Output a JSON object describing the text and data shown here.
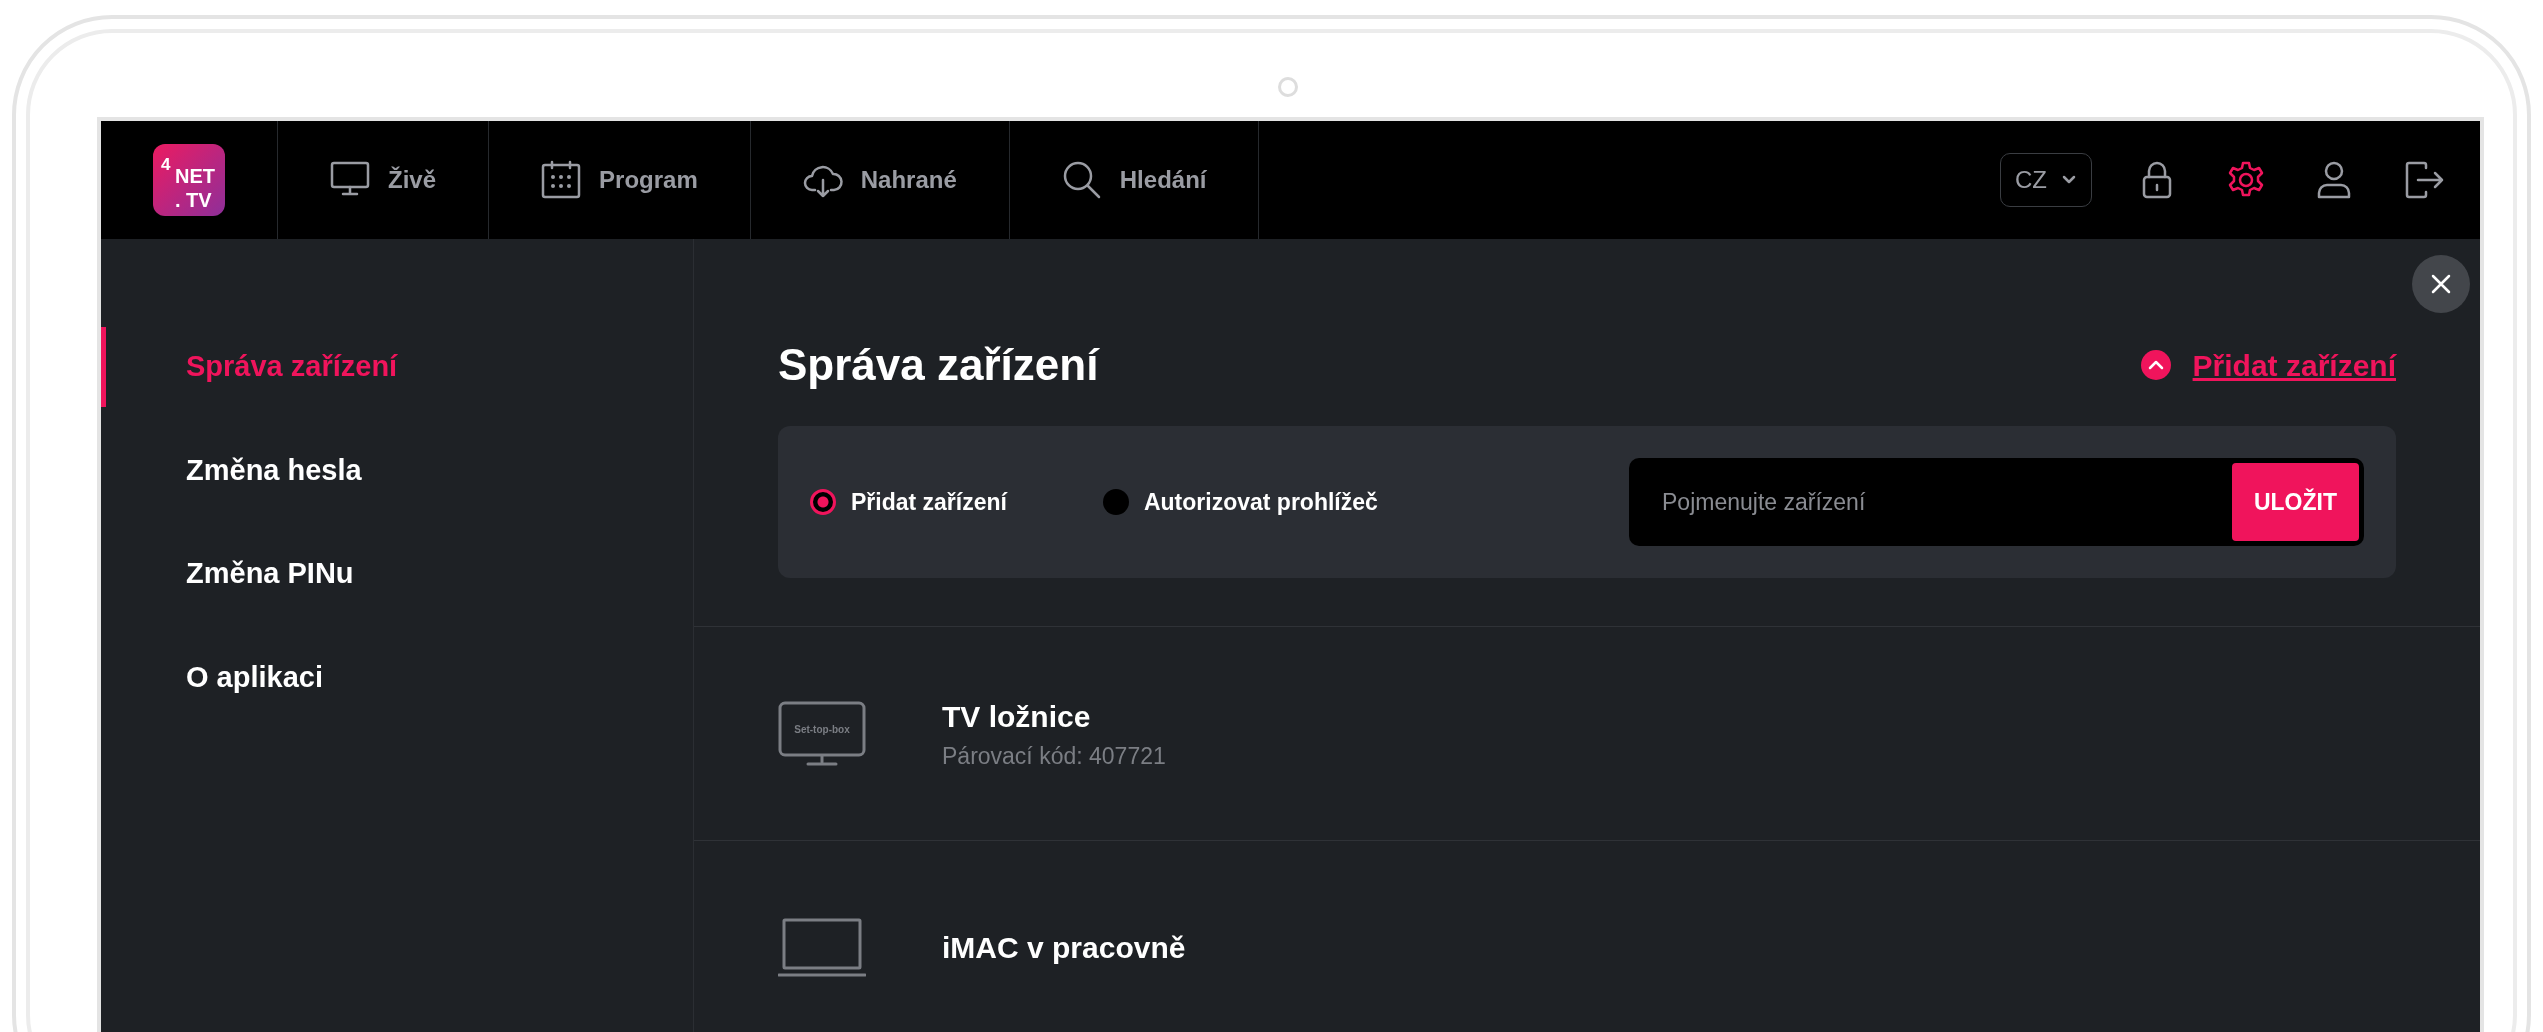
{
  "logo": {
    "lines": [
      "4",
      "NET",
      ". TV"
    ]
  },
  "nav": [
    {
      "kind": "monitor",
      "label": "Živě"
    },
    {
      "kind": "calendar",
      "label": "Program"
    },
    {
      "kind": "cloud",
      "label": "Nahrané"
    },
    {
      "kind": "search",
      "label": "Hledání"
    }
  ],
  "language": {
    "value": "CZ"
  },
  "header_icons": [
    {
      "kind": "lock",
      "selected": false
    },
    {
      "kind": "gear",
      "selected": true
    },
    {
      "kind": "user",
      "selected": false
    },
    {
      "kind": "logout",
      "selected": false
    }
  ],
  "sidebar": {
    "items": [
      {
        "label": "Správa zařízení",
        "selected": true
      },
      {
        "label": "Změna hesla",
        "selected": false
      },
      {
        "label": "Změna PINu",
        "selected": false
      },
      {
        "label": "O aplikaci",
        "selected": false
      }
    ]
  },
  "content": {
    "title": "Správa zařízení",
    "add_link": {
      "label": "Přidat zařízení",
      "expanded": true
    },
    "form": {
      "options": [
        {
          "label": "Přidat zařízení",
          "selected": true
        },
        {
          "label": "Autorizovat prohlížeč",
          "selected": false
        }
      ],
      "name_field": {
        "placeholder": "Pojmenujte zařízení"
      },
      "save_button": "ULOŽIT"
    },
    "devices": [
      {
        "kind": "settopbox",
        "icon_label": "Set-top-box",
        "name": "TV ložnice",
        "code": "Párovací kód: 407721"
      },
      {
        "kind": "laptop",
        "name": "iMAC v pracovně"
      }
    ]
  }
}
